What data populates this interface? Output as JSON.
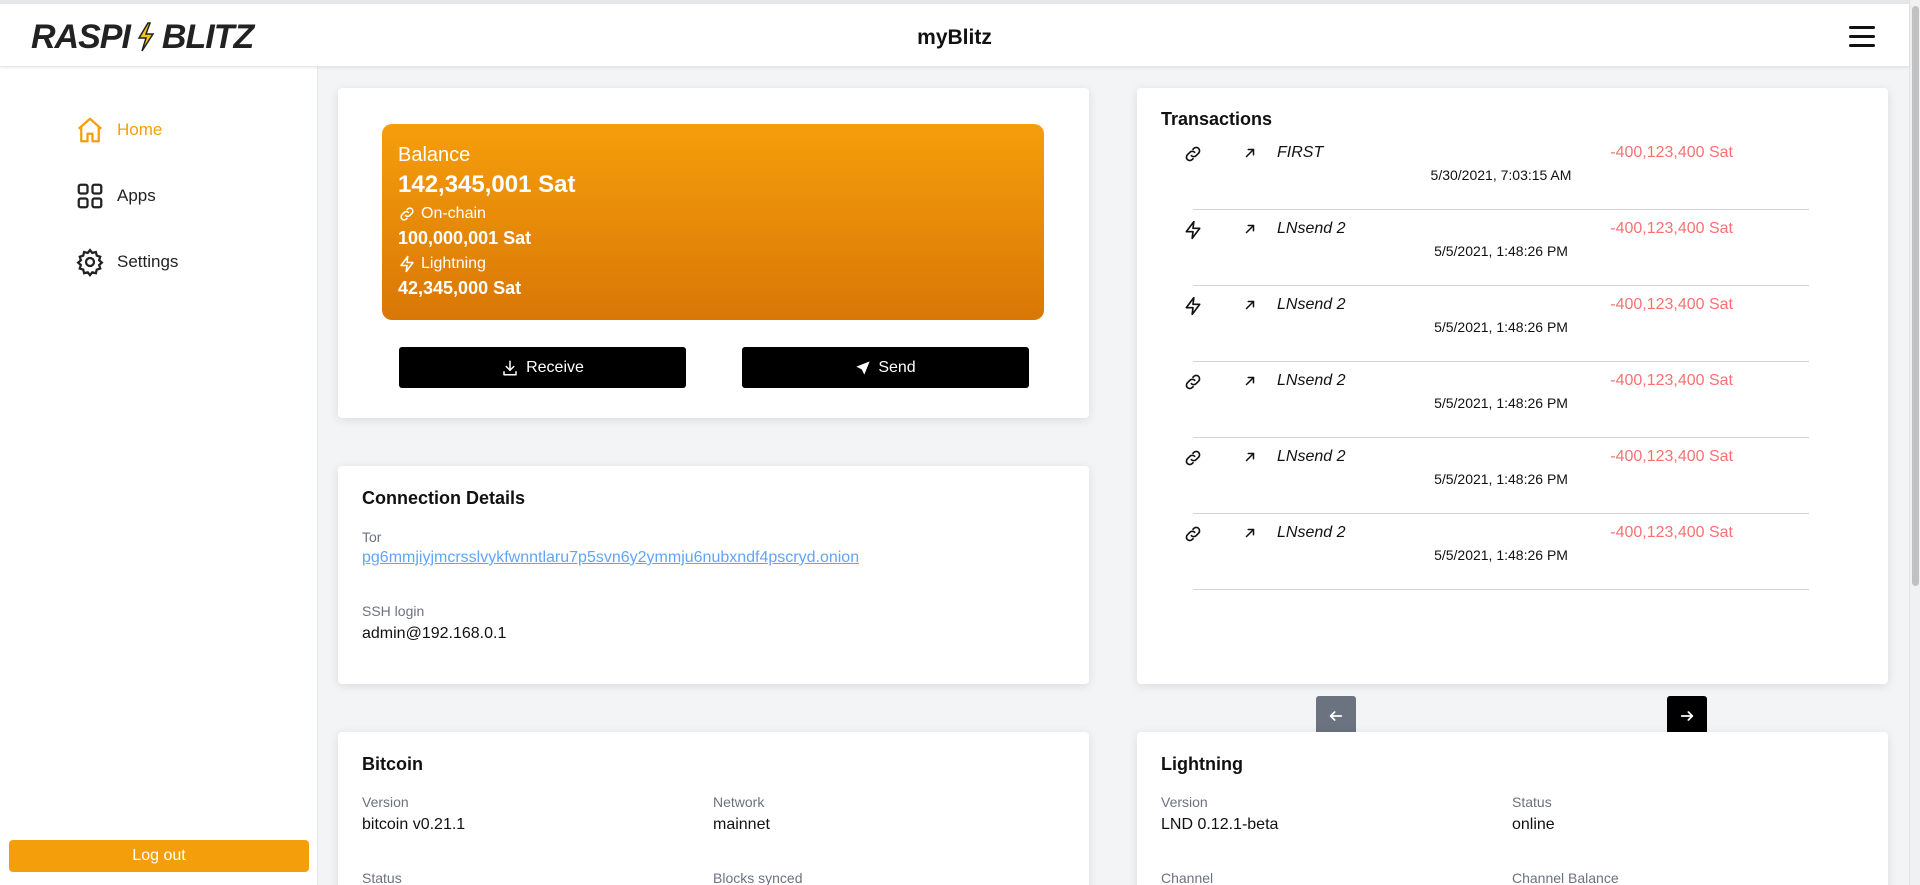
{
  "header": {
    "logo_left": "RASPI",
    "logo_right": "BLITZ",
    "title": "myBlitz"
  },
  "sidebar": {
    "items": [
      {
        "label": "Home",
        "icon": "home-icon",
        "active": true
      },
      {
        "label": "Apps",
        "icon": "apps-grid-icon",
        "active": false
      },
      {
        "label": "Settings",
        "icon": "gear-icon",
        "active": false
      }
    ],
    "logout": "Log out"
  },
  "wallet": {
    "balance_title": "Balance",
    "balance_total": "142,345,001 Sat",
    "onchain_label": "On-chain",
    "onchain_value": "100,000,001 Sat",
    "lightning_label": "Lightning",
    "lightning_value": "42,345,000 Sat",
    "receive": "Receive",
    "send": "Send"
  },
  "connection": {
    "title": "Connection Details",
    "tor_label": "Tor",
    "tor_value": "pg6mmjiyjmcrsslvykfwnntlaru7p5svn6y2ymmju6nubxndf4pscryd.onion",
    "ssh_label": "SSH login",
    "ssh_value": "admin@192.168.0.1"
  },
  "transactions": {
    "title": "Transactions",
    "rows": [
      {
        "type": "link-icon",
        "name": "FIRST",
        "amount": "-400,123,400 Sat",
        "date": "5/30/2021, 7:03:15 AM"
      },
      {
        "type": "lightning-icon",
        "name": "LNsend 2",
        "amount": "-400,123,400 Sat",
        "date": "5/5/2021, 1:48:26 PM"
      },
      {
        "type": "lightning-icon",
        "name": "LNsend 2",
        "amount": "-400,123,400 Sat",
        "date": "5/5/2021, 1:48:26 PM"
      },
      {
        "type": "link-icon",
        "name": "LNsend 2",
        "amount": "-400,123,400 Sat",
        "date": "5/5/2021, 1:48:26 PM"
      },
      {
        "type": "link-icon",
        "name": "LNsend 2",
        "amount": "-400,123,400 Sat",
        "date": "5/5/2021, 1:48:26 PM"
      },
      {
        "type": "link-icon",
        "name": "LNsend 2",
        "amount": "-400,123,400 Sat",
        "date": "5/5/2021, 1:48:26 PM"
      }
    ]
  },
  "bitcoin": {
    "title": "Bitcoin",
    "version_label": "Version",
    "version_value": "bitcoin v0.21.1",
    "network_label": "Network",
    "network_value": "mainnet",
    "status_label": "Status",
    "blocks_label": "Blocks synced"
  },
  "lightning": {
    "title": "Lightning",
    "version_label": "Version",
    "version_value": "LND 0.12.1-beta",
    "status_label": "Status",
    "status_value": "online",
    "channel_label": "Channel",
    "channel_balance_label": "Channel Balance"
  },
  "colors": {
    "accent": "#f59e0b",
    "negative": "#f87171",
    "link": "#60a5fa"
  }
}
